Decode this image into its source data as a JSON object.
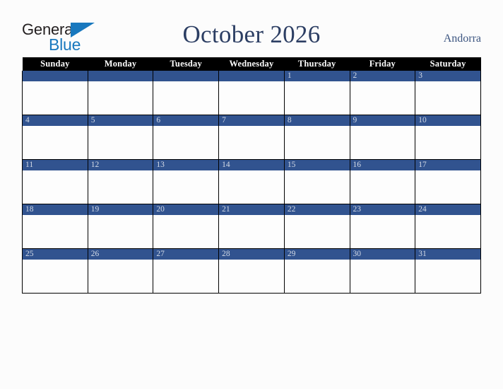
{
  "brand": {
    "name_part1": "General",
    "name_part2": "Blue",
    "triangle_icon": "triangle-icon",
    "accent_color": "#1878be",
    "text_color": "#231f20"
  },
  "header": {
    "month_title": "October 2026",
    "country": "Andorra",
    "title_color": "#2c3e63",
    "country_color": "#3c5580"
  },
  "calendar": {
    "header_background": "#000000",
    "header_text_color": "#ffffff",
    "daybar_color": "#31538f",
    "daynum_color": "#d3dae6",
    "cell_background": "#fdfdfd",
    "border_color": "#000000",
    "weekdays": [
      "Sunday",
      "Monday",
      "Tuesday",
      "Wednesday",
      "Thursday",
      "Friday",
      "Saturday"
    ],
    "weeks": [
      [
        "",
        "",
        "",
        "",
        "1",
        "2",
        "3"
      ],
      [
        "4",
        "5",
        "6",
        "7",
        "8",
        "9",
        "10"
      ],
      [
        "11",
        "12",
        "13",
        "14",
        "15",
        "16",
        "17"
      ],
      [
        "18",
        "19",
        "20",
        "21",
        "22",
        "23",
        "24"
      ],
      [
        "25",
        "26",
        "27",
        "28",
        "29",
        "30",
        "31"
      ]
    ]
  },
  "page": {
    "background": "#fcfcfc"
  }
}
